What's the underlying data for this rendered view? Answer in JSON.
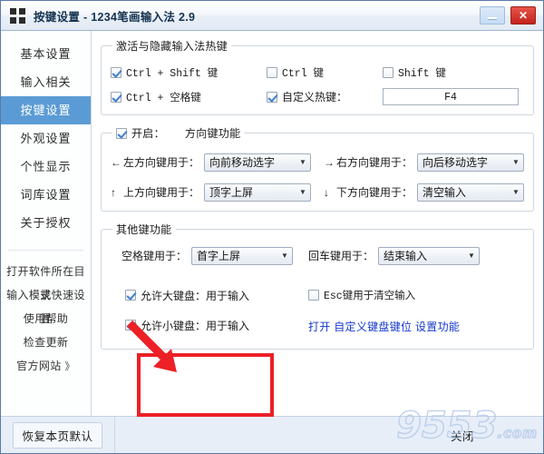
{
  "window": {
    "title": "按键设置 - 1234笔画输入法 2.9",
    "icon": "app-grid-icon",
    "minimize_label": "",
    "close_label": "✕",
    "accent_color": "#5b9bd5",
    "annotation_color": "#ec2026",
    "link_color": "#1638d0"
  },
  "sidebar": {
    "items": [
      {
        "label": "基本设置",
        "selected": false
      },
      {
        "label": "输入相关",
        "selected": false
      },
      {
        "label": "按键设置",
        "selected": true
      },
      {
        "label": "外观设置",
        "selected": false
      },
      {
        "label": "个性显示",
        "selected": false
      },
      {
        "label": "词库设置",
        "selected": false
      },
      {
        "label": "关于授权",
        "selected": false
      }
    ],
    "links": [
      {
        "label": "打开软件所在目录"
      },
      {
        "label": "输入模式快速设置"
      },
      {
        "label": "使用帮助"
      },
      {
        "label": "检查更新"
      },
      {
        "label": "官方网站",
        "chevron": "》"
      }
    ]
  },
  "groups": {
    "hotkeys": {
      "title": "激活与隐藏输入法热键",
      "checkboxes": [
        {
          "label": "Ctrl + Shift 键",
          "checked": true
        },
        {
          "label": "Ctrl 键",
          "checked": false
        },
        {
          "label": "Shift 键",
          "checked": false
        },
        {
          "label": "Ctrl + 空格键",
          "checked": true
        },
        {
          "label": "自定义热键：",
          "checked": true
        }
      ],
      "custom_hotkey_value": "F4"
    },
    "arrows": {
      "enable_label": "开启：",
      "title": "方向键功能",
      "enabled": true,
      "fields": [
        {
          "glyph": "←",
          "label": "左方向键用于：",
          "value": "向前移动选字"
        },
        {
          "glyph": "→",
          "label": "右方向键用于：",
          "value": "向后移动选字"
        },
        {
          "glyph": "↑",
          "label": "上方向键用于：",
          "value": "顶字上屏"
        },
        {
          "glyph": "↓",
          "label": "下方向键用于：",
          "value": "清空输入"
        }
      ]
    },
    "otherkeys": {
      "title": "其他键功能",
      "fields": [
        {
          "label": "空格键用于：",
          "value": "首字上屏"
        },
        {
          "label": "回车键用于：",
          "value": "结束输入"
        }
      ],
      "checkboxes": [
        {
          "label": "允许大键盘：用于输入",
          "checked": true
        },
        {
          "label": "允许小键盘：用于输入",
          "checked": true
        },
        {
          "label": "Esc键用于清空输入",
          "checked": false
        }
      ],
      "links": [
        "打开",
        "自定义键盘键位",
        "设置功能"
      ]
    }
  },
  "footer": {
    "reset_label": "恢复本页默认",
    "close_label": "关闭",
    "watermark": "9553",
    "watermark_suffix": ".com"
  }
}
